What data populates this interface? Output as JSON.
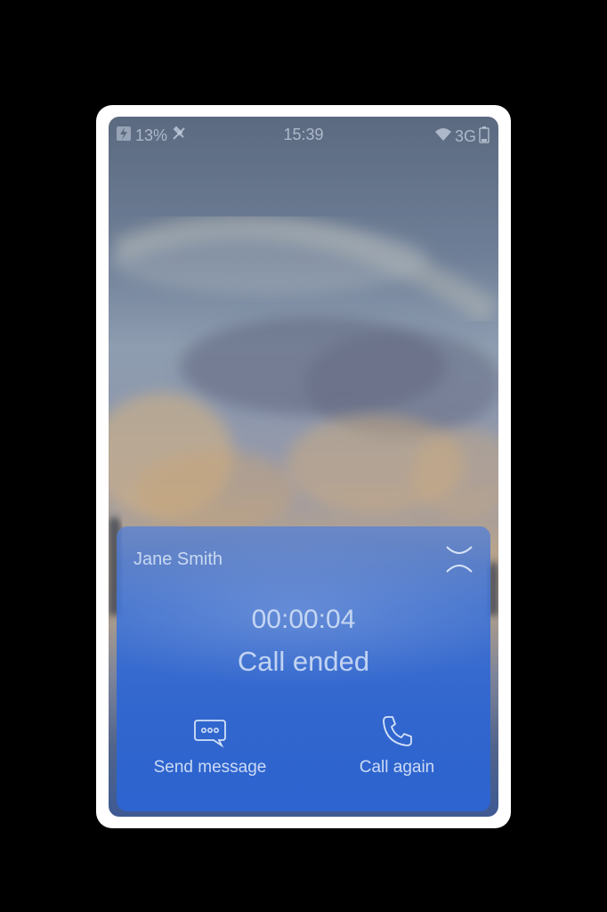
{
  "status_bar": {
    "battery_percent": "13%",
    "time": "15:39",
    "network": "3G",
    "icons": [
      "charging-icon",
      "mute-icon",
      "wifi-icon",
      "network-icon",
      "battery-icon"
    ]
  },
  "call_card": {
    "caller_name": "Jane Smith",
    "duration": "00:00:04",
    "status": "Call ended",
    "actions": [
      {
        "label": "Send message",
        "icon": "message-bubble-icon"
      },
      {
        "label": "Call again",
        "icon": "phone-icon"
      }
    ],
    "close_icon": "close-icon"
  },
  "colors": {
    "card_blue": "#2e66d4",
    "frame": "#ffffff",
    "background": "#000000"
  }
}
